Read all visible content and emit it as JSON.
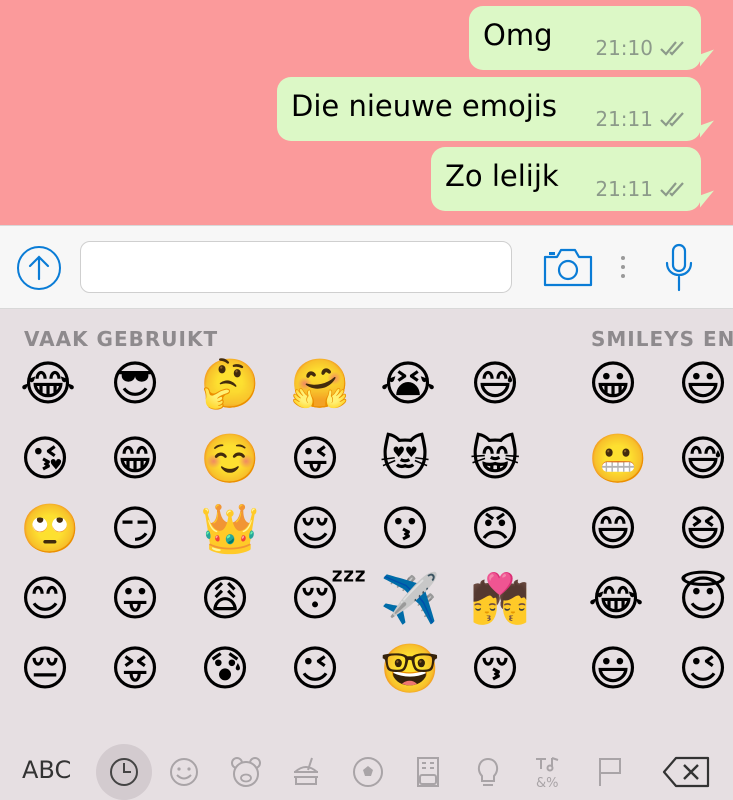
{
  "messages": [
    {
      "text": "Omg",
      "time": "21:10"
    },
    {
      "text": "Die nieuwe emojis",
      "time": "21:11"
    },
    {
      "text": "Zo lelijk",
      "time": "21:11"
    }
  ],
  "input": {
    "placeholder": ""
  },
  "keyboard": {
    "section_frequent": "VAAK GEBRUIKT",
    "section_smileys": "SMILEYS EN",
    "abc_label": "ABC",
    "categories": [
      "recent",
      "smileys",
      "animals",
      "food",
      "activity",
      "travel",
      "objects",
      "symbols",
      "flags"
    ],
    "selected_category": "recent",
    "emojis": [
      [
        "😂",
        "😎",
        "🤔",
        "🤗",
        "😭",
        "😅",
        "",
        "😀",
        "😃"
      ],
      [
        "😘",
        "😁",
        "☺️",
        "😜",
        "😻",
        "😸",
        "",
        "😬",
        "😅"
      ],
      [
        "🙄",
        "😏",
        "👑",
        "😌",
        "😗",
        "😠",
        "",
        "😄",
        "😆"
      ],
      [
        "😊",
        "😛",
        "😩",
        "😴",
        "✈️",
        "💏",
        "",
        "😂",
        "😇"
      ],
      [
        "😔",
        "😝",
        "😰",
        "😉",
        "🤓",
        "😚",
        "",
        "😃",
        "😉"
      ]
    ]
  },
  "colors": {
    "chat_bg": "#fb9a9b",
    "bubble": "#dcf8c6",
    "accent": "#0a7cd6"
  }
}
